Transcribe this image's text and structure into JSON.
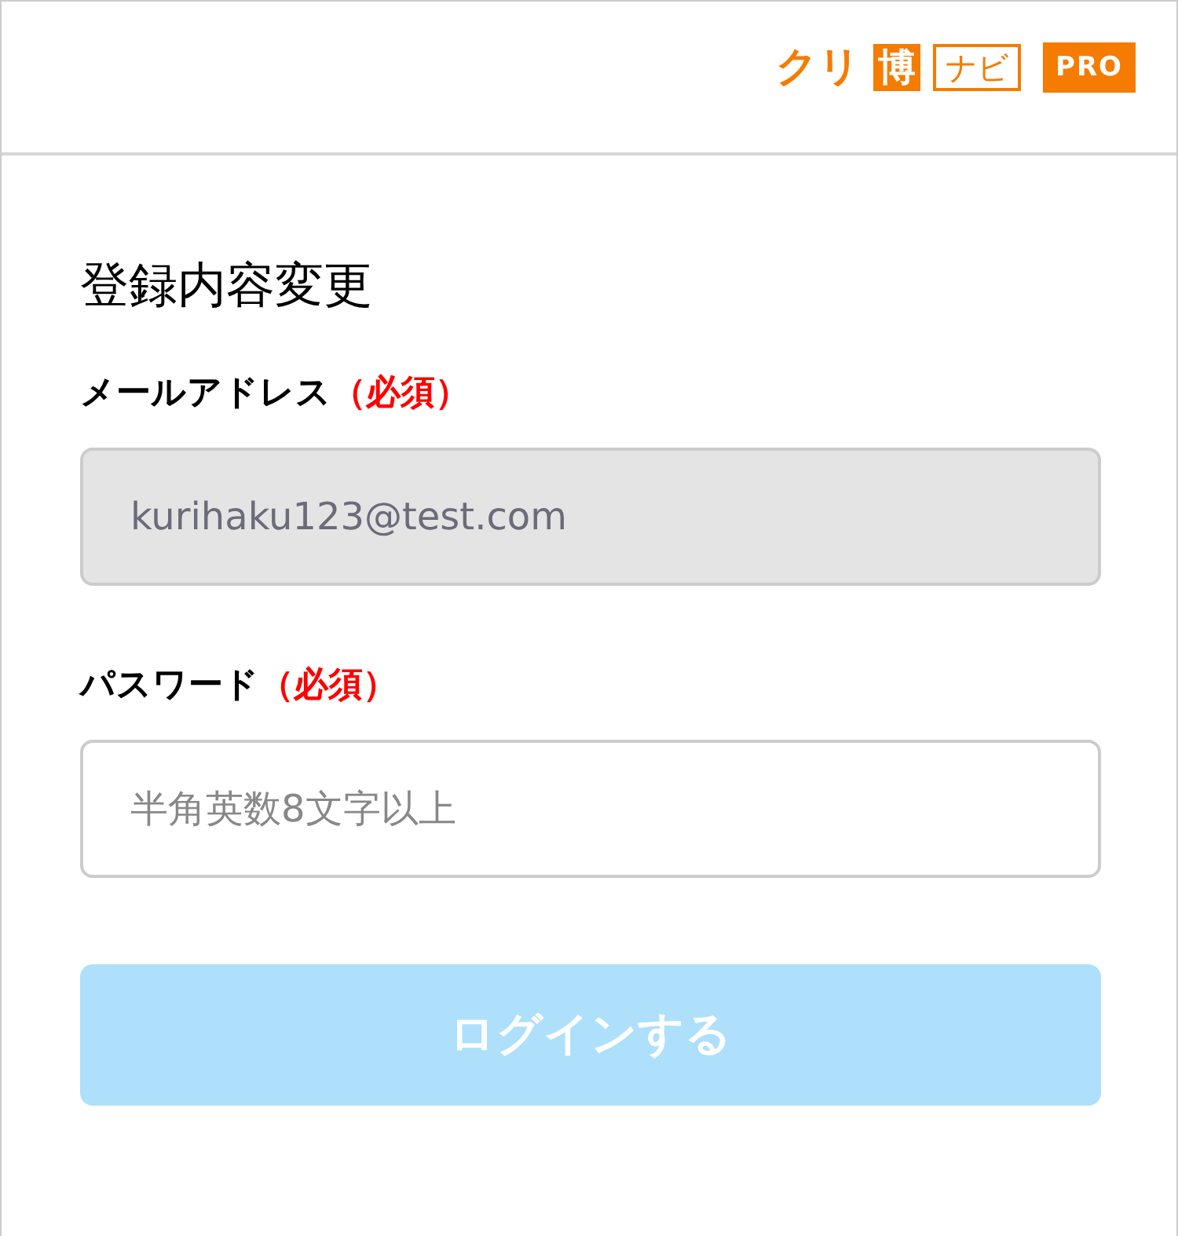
{
  "logo": {
    "part_1": "クリ",
    "part_2": "博",
    "part_3": "ナビ",
    "badge": "PRO"
  },
  "title": "登録内容変更",
  "fields": [
    {
      "label": "メールアドレス",
      "required_mark": "（必須）",
      "value": "kurihaku123@test.com",
      "disabled": true
    },
    {
      "label": "パスワード",
      "required_mark": "（必須）",
      "placeholder": "半角英数8文字以上",
      "disabled": false
    }
  ],
  "submit": {
    "label": "ログインする",
    "disabled": true
  }
}
